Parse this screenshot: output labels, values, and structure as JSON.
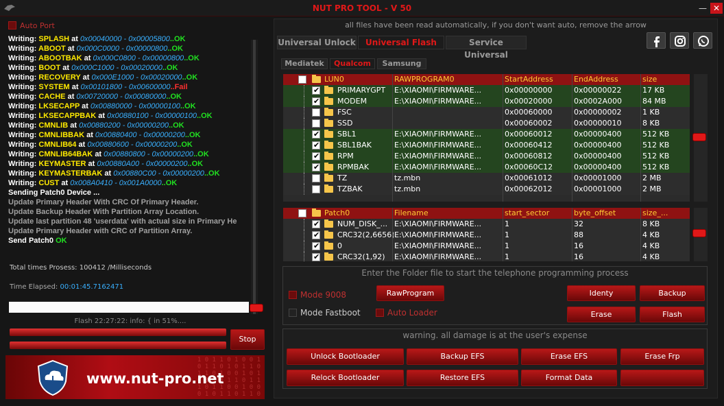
{
  "window": {
    "title": "NUT PRO TOOL - V 50",
    "min": "—",
    "close": "✕"
  },
  "left": {
    "auto_port": "Auto Port",
    "log": [
      [
        [
          "Writing: ",
          "w"
        ],
        [
          "SPLASH ",
          "y"
        ],
        [
          "at ",
          "w"
        ],
        [
          "0x00040000 - 0x00005800",
          "a"
        ],
        [
          "..OK",
          "g"
        ]
      ],
      [
        [
          "Writing: ",
          "w"
        ],
        [
          "ABOOT ",
          "y"
        ],
        [
          "at ",
          "w"
        ],
        [
          "0x000C0000 - 0x00000800",
          "a"
        ],
        [
          "..OK",
          "g"
        ]
      ],
      [
        [
          "Writing: ",
          "w"
        ],
        [
          "ABOOTBAK ",
          "y"
        ],
        [
          "at ",
          "w"
        ],
        [
          "0x000C0800 - 0x00000800",
          "a"
        ],
        [
          "..OK",
          "g"
        ]
      ],
      [
        [
          "Writing: ",
          "w"
        ],
        [
          "BOOT ",
          "y"
        ],
        [
          "at ",
          "w"
        ],
        [
          "0x000C1000 - 0x00020000",
          "a"
        ],
        [
          "..OK",
          "g"
        ]
      ],
      [
        [
          "Writing: ",
          "w"
        ],
        [
          "RECOVERY ",
          "y"
        ],
        [
          "at ",
          "w"
        ],
        [
          "0x000E1000 - 0x00020000",
          "a"
        ],
        [
          "..OK",
          "g"
        ]
      ],
      [
        [
          "Writing: ",
          "w"
        ],
        [
          "SYSTEM ",
          "y"
        ],
        [
          "at ",
          "w"
        ],
        [
          "0x00101800 - 0x00600000",
          "a"
        ],
        [
          "..Fail",
          "r"
        ]
      ],
      [
        [
          "Writing: ",
          "w"
        ],
        [
          "CACHE ",
          "y"
        ],
        [
          "at ",
          "w"
        ],
        [
          "0x00720000 - 0x00080000",
          "a"
        ],
        [
          "..OK",
          "g"
        ]
      ],
      [
        [
          "Writing: ",
          "w"
        ],
        [
          "LKSECAPP ",
          "y"
        ],
        [
          "at ",
          "w"
        ],
        [
          "0x00880000 - 0x00000100",
          "a"
        ],
        [
          "..OK",
          "g"
        ]
      ],
      [
        [
          "Writing: ",
          "w"
        ],
        [
          "LKSECAPPBAK ",
          "y"
        ],
        [
          "at ",
          "w"
        ],
        [
          "0x00880100 - 0x00000100",
          "a"
        ],
        [
          "..OK",
          "g"
        ]
      ],
      [
        [
          "Writing: ",
          "w"
        ],
        [
          "CMNLIB ",
          "y"
        ],
        [
          "at ",
          "w"
        ],
        [
          "0x00880200 - 0x00000200",
          "a"
        ],
        [
          "..OK",
          "g"
        ]
      ],
      [
        [
          "Writing: ",
          "w"
        ],
        [
          "CMNLIBBAK ",
          "y"
        ],
        [
          "at ",
          "w"
        ],
        [
          "0x00880400 - 0x00000200",
          "a"
        ],
        [
          "..OK",
          "g"
        ]
      ],
      [
        [
          "Writing: ",
          "w"
        ],
        [
          "CMNLIB64 ",
          "y"
        ],
        [
          "at ",
          "w"
        ],
        [
          "0x00880600 - 0x00000200",
          "a"
        ],
        [
          "..OK",
          "g"
        ]
      ],
      [
        [
          "Writing: ",
          "w"
        ],
        [
          "CMNLIB64BAK ",
          "y"
        ],
        [
          "at ",
          "w"
        ],
        [
          "0x00880800 - 0x00000200",
          "a"
        ],
        [
          "..OK",
          "g"
        ]
      ],
      [
        [
          "Writing: ",
          "w"
        ],
        [
          "KEYMASTER ",
          "y"
        ],
        [
          "at ",
          "w"
        ],
        [
          "0x00880A00 - 0x00000200",
          "a"
        ],
        [
          "..OK",
          "g"
        ]
      ],
      [
        [
          "Writing: ",
          "w"
        ],
        [
          "KEYMASTERBAK ",
          "y"
        ],
        [
          "at ",
          "w"
        ],
        [
          "0x00880C00 - 0x00000200",
          "a"
        ],
        [
          "..OK",
          "g"
        ]
      ],
      [
        [
          "Writing: ",
          "w"
        ],
        [
          "CUST ",
          "y"
        ],
        [
          "at ",
          "w"
        ],
        [
          "0x008A0410 - 0x001A0000",
          "a"
        ],
        [
          "..OK",
          "g"
        ]
      ],
      [
        [
          "Sending Patch0 Device ...",
          "w"
        ]
      ],
      [
        [
          "Update Primary Header With CRC Of Primary Header.",
          "gr"
        ]
      ],
      [
        [
          "Update Backup Header With Partition Array Location.",
          "gr"
        ]
      ],
      [
        [
          "Update last partition 48 'userdata' with actual size in Primary He",
          "gr"
        ]
      ],
      [
        [
          "Update Primary Header with CRC of Partition Array.",
          "gr"
        ]
      ],
      [
        [
          "Send Patch0 ",
          "w"
        ],
        [
          "OK",
          "g"
        ]
      ]
    ],
    "total": "Total times Prosess: 100412 /Milliseconds",
    "elapsed_label": "Time Elapsed:",
    "elapsed_value": "00:01:45.7162471",
    "flash_status": "Flash 22:27:22: info: { in 51%....",
    "stop": "Stop",
    "banner_url": "www.nut-pro.net"
  },
  "right": {
    "notice": "all files have been read automatically, if you don't want auto, remove the arrow",
    "tabs": [
      "Universal Unlock",
      "Universal Flash",
      "Service Universal"
    ],
    "subtabs": [
      "Mediatek",
      "Qualcom",
      "Samsung"
    ],
    "grid1": {
      "headers": [
        "LUN0",
        "RAWPROGRAM0",
        "StartAddress",
        "EndAddress",
        "size"
      ],
      "rows": [
        {
          "name": "PRIMARYGPT",
          "file": "E:\\XIAOMI\\FIRMWARE...",
          "start": "0x00000000",
          "end": "0x00000022",
          "size": "17 KB",
          "checked": true
        },
        {
          "name": "MODEM",
          "file": "E:\\XIAOMI\\FIRMWARE...",
          "start": "0x00020000",
          "end": "0x0002A000",
          "size": "84 MB",
          "checked": true
        },
        {
          "name": "FSC",
          "file": "",
          "start": "0x00060000",
          "end": "0x00000002",
          "size": "1 KB",
          "checked": false
        },
        {
          "name": "SSD",
          "file": "",
          "start": "0x00060002",
          "end": "0x00000010",
          "size": "8 KB",
          "checked": false
        },
        {
          "name": "SBL1",
          "file": "E:\\XIAOMI\\FIRMWARE...",
          "start": "0x00060012",
          "end": "0x00000400",
          "size": "512 KB",
          "checked": true
        },
        {
          "name": "SBL1BAK",
          "file": "E:\\XIAOMI\\FIRMWARE...",
          "start": "0x00060412",
          "end": "0x00000400",
          "size": "512 KB",
          "checked": true
        },
        {
          "name": "RPM",
          "file": "E:\\XIAOMI\\FIRMWARE...",
          "start": "0x00060812",
          "end": "0x00000400",
          "size": "512 KB",
          "checked": true
        },
        {
          "name": "RPMBAK",
          "file": "E:\\XIAOMI\\FIRMWARE...",
          "start": "0x00060C12",
          "end": "0x00000400",
          "size": "512 KB",
          "checked": true
        },
        {
          "name": "TZ",
          "file": "tz.mbn",
          "start": "0x00061012",
          "end": "0x00001000",
          "size": "2 MB",
          "checked": false
        },
        {
          "name": "TZBAK",
          "file": "tz.mbn",
          "start": "0x00062012",
          "end": "0x00001000",
          "size": "2 MB",
          "checked": false
        }
      ]
    },
    "grid2": {
      "headers": [
        "Patch0",
        "Filename",
        "start_sector",
        "byte_offset",
        "size_..."
      ],
      "rows": [
        {
          "name": "NUM_DISK_...",
          "file": "E:\\XIAOMI\\FIRMWARE...",
          "start": "1",
          "end": "32",
          "size": "8 KB",
          "checked": true
        },
        {
          "name": "CRC32(2,6656)",
          "file": "E:\\XIAOMI\\FIRMWARE...",
          "start": "1",
          "end": "88",
          "size": "4 KB",
          "checked": true
        },
        {
          "name": "0",
          "file": "E:\\XIAOMI\\FIRMWARE...",
          "start": "1",
          "end": "16",
          "size": "4 KB",
          "checked": true
        },
        {
          "name": "CRC32(1,92)",
          "file": "E:\\XIAOMI\\FIRMWARE...",
          "start": "1",
          "end": "16",
          "size": "4 KB",
          "checked": true
        }
      ]
    },
    "sect1_title": "Enter the Folder file to start the telephone programming process",
    "mode9008": "Mode 9008",
    "mode_fastboot": "Mode Fastboot",
    "auto_loader": "Auto Loader",
    "buttons1": {
      "rawprogram": "RawProgram",
      "identy": "Identy",
      "backup": "Backup",
      "erase": "Erase",
      "flash": "Flash"
    },
    "sect2_title": "warning. all damage is at the user's expense",
    "buttons2": [
      "Unlock Bootloader",
      "Backup EFS",
      "Erase EFS",
      "Erase Frp",
      "Relock Bootloader",
      "Restore EFS",
      "Format Data",
      ""
    ]
  }
}
